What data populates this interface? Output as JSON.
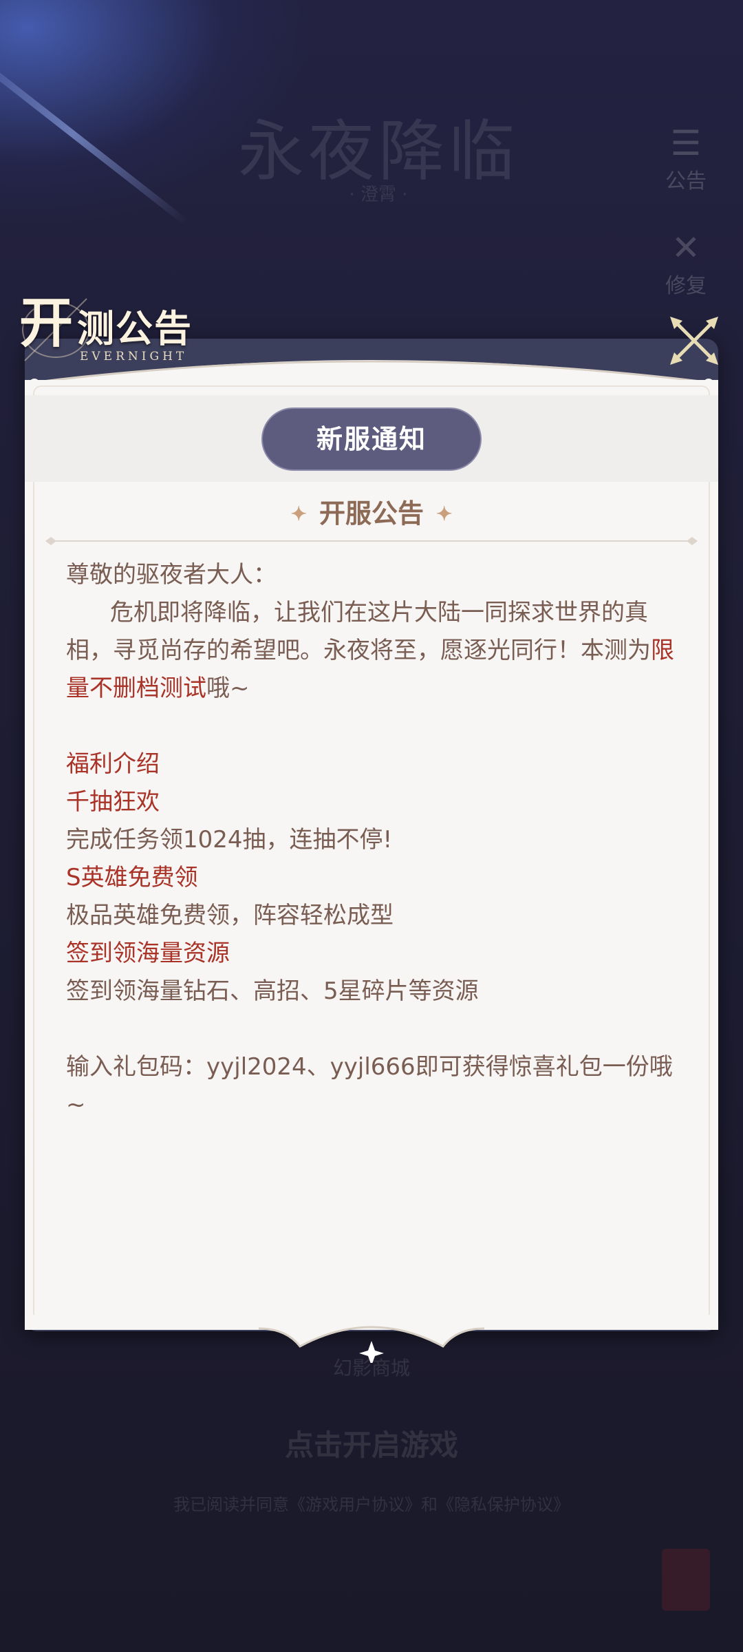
{
  "background": {
    "logo_text": "永夜降临",
    "logo_sub": "· 澄霄 ·",
    "side_buttons": [
      {
        "label": "公告",
        "icon": "notice-icon"
      },
      {
        "label": "修复",
        "icon": "repair-icon"
      }
    ],
    "bottom_hints": [
      "幻影商城",
      "点击开启游戏",
      "我已阅读并同意《游戏用户协议》和《隐私保护协议》"
    ]
  },
  "header": {
    "title_big": "开",
    "title_rest": "测公告",
    "title_en": "EVERNIGHT"
  },
  "tabs": [
    {
      "label": "新服通知",
      "active": true
    }
  ],
  "section_title": "开服公告",
  "body": {
    "greeting": "尊敬的驱夜者大人：",
    "intro_part1": "危机即将降临，让我们在这片大陆一同探求世界的真相，寻觅尚存的希望吧。永夜将至，愿逐光同行！本测为",
    "intro_highlight": "限量不删档测试",
    "intro_part2": "哦~",
    "welfare_title": "福利介绍",
    "items": [
      {
        "title": "千抽狂欢",
        "desc": "完成任务领1024抽，连抽不停!"
      },
      {
        "title": "S英雄免费领",
        "desc": "极品英雄免费领，阵容轻松成型"
      },
      {
        "title": "签到领海量资源",
        "desc": "签到领海量钻石、高招、5星碎片等资源"
      }
    ],
    "gift_code": "输入礼包码：yyjl2024、yyjl666即可获得惊喜礼包一份哦~"
  },
  "colors": {
    "panel_bg": "#f7f6f5",
    "frame": "#3c3f5c",
    "tab_active": "#5d5c7e",
    "text": "#7a5d52",
    "highlight": "#aa3328",
    "section_title": "#8d6a55"
  }
}
